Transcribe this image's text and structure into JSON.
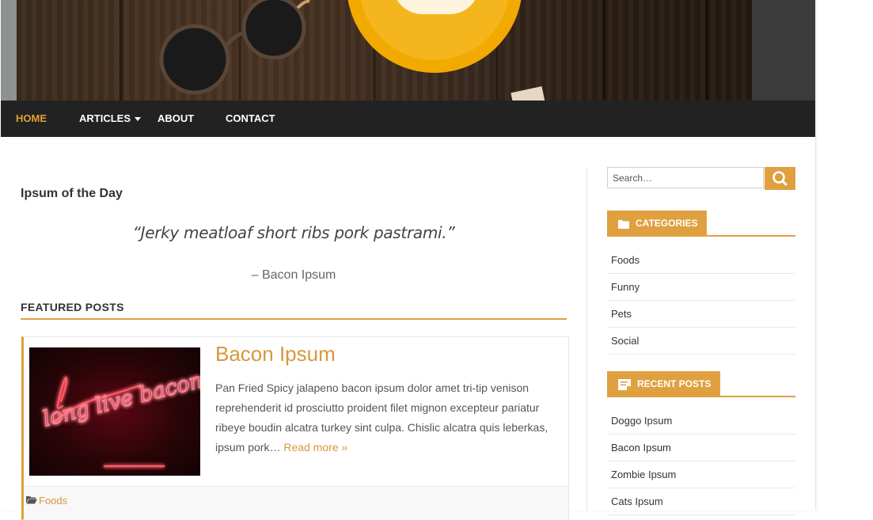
{
  "nav": {
    "items": [
      {
        "label": "HOME",
        "active": true
      },
      {
        "label": "ARTICLES",
        "has_dropdown": true
      },
      {
        "label": "ABOUT"
      },
      {
        "label": "CONTACT"
      }
    ]
  },
  "ipsum_widget": {
    "title": "Ipsum of the Day",
    "quote": "“Jerky meatloaf short ribs pork pastrami.”",
    "author": "– Bacon Ipsum"
  },
  "featured": {
    "heading": "FEATURED POSTS",
    "post": {
      "title": "Bacon Ipsum",
      "excerpt": "Pan Fried Spicy jalapeno bacon ipsum dolor amet tri-tip venison reprehenderit id prosciutto proident filet mignon excepteur pariatur ribeye boudin alcatra turkey sint culpa. Chislic alcatra quis leberkas, ipsum pork…",
      "read_more": "Read more »",
      "image_text": "long live bacon",
      "category": "Foods"
    }
  },
  "sidebar": {
    "search_placeholder": "Search…",
    "categories_title": "CATEGORIES",
    "categories": [
      "Foods",
      "Funny",
      "Pets",
      "Social"
    ],
    "recent_title": "RECENT POSTS",
    "recent_posts": [
      "Doggo Ipsum",
      "Bacon Ipsum",
      "Zombie Ipsum",
      "Cats Ipsum"
    ]
  },
  "colors": {
    "accent": "#e0a040",
    "nav_bg": "#222222",
    "link": "#d9973a"
  }
}
